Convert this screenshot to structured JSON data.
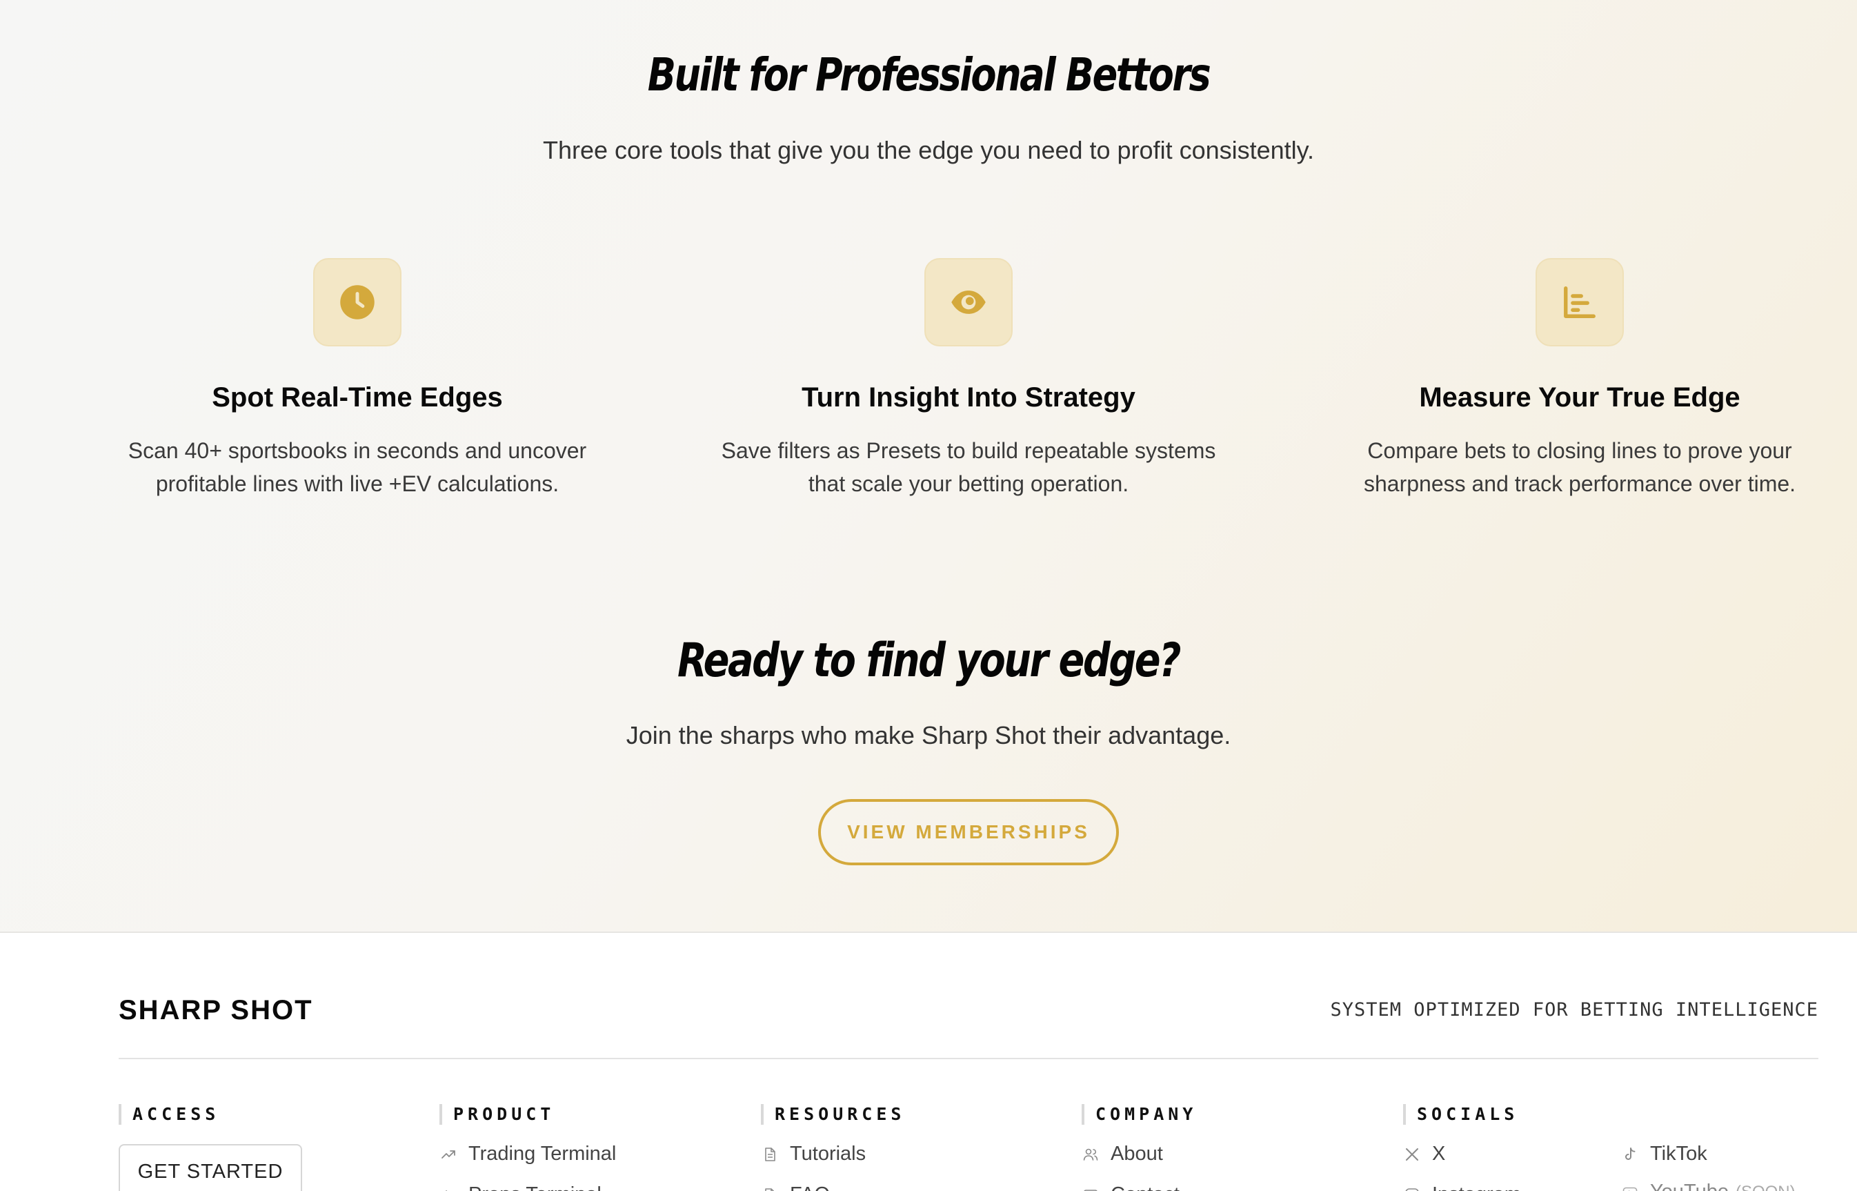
{
  "hero": {
    "title": "Built for Professional Bettors",
    "subtitle": "Three core tools that give you the edge you need to profit consistently."
  },
  "features": [
    {
      "icon": "clock-icon",
      "title": "Spot Real-Time Edges",
      "line1": "Scan 40+ sportsbooks in seconds and uncover",
      "line2": "profitable lines with live +EV calculations."
    },
    {
      "icon": "eye-icon",
      "title": "Turn Insight Into Strategy",
      "line1": "Save filters as Presets to build repeatable systems",
      "line2": "that scale your betting operation."
    },
    {
      "icon": "bar-chart-icon",
      "title": "Measure Your True Edge",
      "line1": "Compare bets to closing lines to prove your",
      "line2": "sharpness and track performance over time."
    }
  ],
  "cta": {
    "title": "Ready to find your edge?",
    "subtitle": "Join the sharps who make Sharp Shot their advantage.",
    "button": "VIEW MEMBERSHIPS"
  },
  "footer": {
    "brand": "SHARP SHOT",
    "tagline": "SYSTEM OPTIMIZED FOR BETTING INTELLIGENCE",
    "access": {
      "heading": "ACCESS",
      "button": "GET STARTED"
    },
    "product": {
      "heading": "PRODUCT",
      "link1": "Trading Terminal",
      "link2": "Props Terminal"
    },
    "resources": {
      "heading": "RESOURCES",
      "link1": "Tutorials",
      "link2": "FAQ"
    },
    "company": {
      "heading": "COMPANY",
      "link1": "About",
      "link2": "Contact"
    },
    "socials": {
      "heading": "SOCIALS",
      "x": "X",
      "instagram": "Instagram",
      "tiktok": "TikTok",
      "youtube": "YouTube",
      "youtube_note": "(SOON)"
    }
  },
  "colors": {
    "accent": "#d4a93c",
    "icon_bg": "#f3e7c6"
  }
}
